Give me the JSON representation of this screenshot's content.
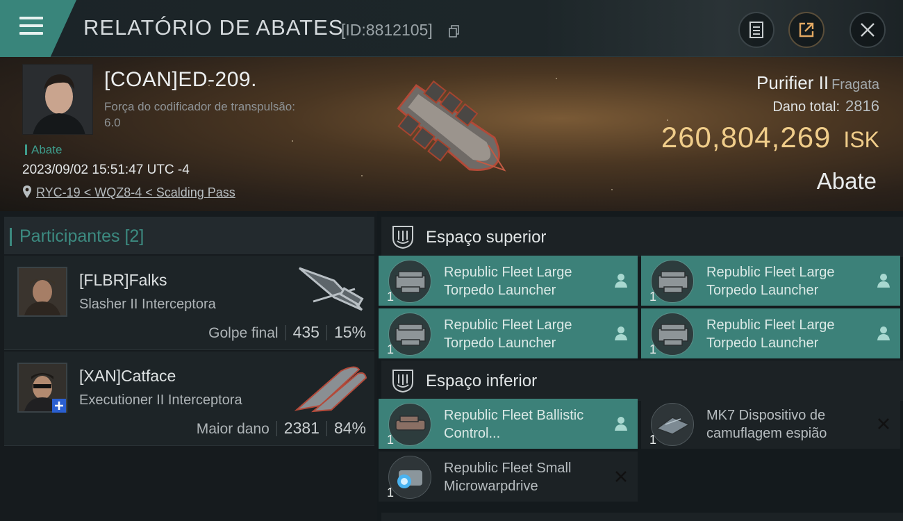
{
  "header": {
    "title": "RELATÓRIO DE ABATES",
    "report_id": "[ID:8812105]",
    "menu_icon": "hamburger-menu-icon",
    "buttons": [
      "notes-icon",
      "share-icon",
      "close-icon"
    ],
    "accent": "#39857b"
  },
  "victim": {
    "name": "[COAN]ED-209.",
    "attribute_label": "Força do codificador de transpulsão:",
    "attribute_value": "6.0",
    "kill_tag": "Abate",
    "datetime": "2023/09/02 15:51:47 UTC -4",
    "location": "RYC-19 < WQZ8-4 < Scalding Pass",
    "ship_name": "Purifier II",
    "ship_class": "Fragata",
    "damage_label": "Dano total:",
    "damage_value": "2816",
    "isk_value": "260,804,269",
    "isk_unit": "ISK",
    "result": "Abate",
    "isk_color": "#f0cd8a"
  },
  "participants": {
    "header": "Participantes [2]",
    "list": [
      {
        "name": "[FLBR]Falks",
        "ship": "Slasher II Interceptora",
        "role": "Golpe final",
        "damage": "435",
        "percent": "15%"
      },
      {
        "name": "[XAN]Catface",
        "ship": "Executioner II Interceptora",
        "role": "Maior dano",
        "damage": "2381",
        "percent": "84%"
      }
    ]
  },
  "slots": {
    "high": {
      "title": "Espaço superior",
      "items": [
        {
          "name": "Republic Fleet Large Torpedo Launcher",
          "qty": "1",
          "status": "destroyed",
          "status_icon": "pilot-icon"
        },
        {
          "name": "Republic Fleet Large Torpedo Launcher",
          "qty": "1",
          "status": "destroyed",
          "status_icon": "pilot-icon"
        },
        {
          "name": "Republic Fleet Large Torpedo Launcher",
          "qty": "1",
          "status": "destroyed",
          "status_icon": "pilot-icon"
        },
        {
          "name": "Republic Fleet Large Torpedo Launcher",
          "qty": "1",
          "status": "destroyed",
          "status_icon": "pilot-icon"
        }
      ]
    },
    "low": {
      "title": "Espaço inferior",
      "items": [
        {
          "name": "Republic Fleet Ballistic Control...",
          "qty": "1",
          "status": "destroyed",
          "status_icon": "pilot-icon"
        },
        {
          "name": "MK7 Dispositivo de camuflagem espião",
          "qty": "1",
          "status": "dropped",
          "status_icon": "x-icon"
        },
        {
          "name": "Republic Fleet Small Microwarpdrive",
          "qty": "1",
          "status": "dropped",
          "status_icon": "x-icon"
        }
      ]
    }
  }
}
